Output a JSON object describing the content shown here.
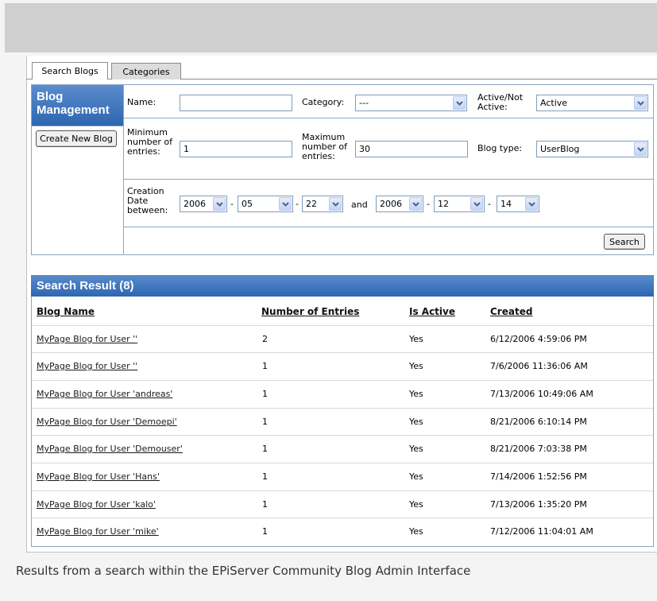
{
  "tabs": [
    {
      "label": "Search Blogs"
    },
    {
      "label": "Categories"
    }
  ],
  "sidebar": {
    "title": "Blog Management",
    "create_button": "Create New Blog"
  },
  "form": {
    "name_label": "Name:",
    "name_value": "",
    "category_label": "Category:",
    "category_value": "---",
    "active_label": "Active/Not Active:",
    "active_value": "Active",
    "min_entries_label": "Minimum number of entries:",
    "min_entries_value": "1",
    "max_entries_label": "Maximum number of entries:",
    "max_entries_value": "30",
    "blog_type_label": "Blog type:",
    "blog_type_value": "UserBlog",
    "creation_date_label": "Creation Date between:",
    "from_year": "2006",
    "from_month": "05",
    "from_day": "22",
    "and_label": "and",
    "to_year": "2006",
    "to_month": "12",
    "to_day": "14",
    "date_separator": "-",
    "search_button": "Search"
  },
  "results": {
    "title": "Search Result (8)",
    "columns": [
      "Blog Name",
      "Number of Entries",
      "Is Active",
      "Created"
    ],
    "rows": [
      {
        "name": "MyPage Blog for User ''",
        "entries": "2",
        "active": "Yes",
        "created": "6/12/2006 4:59:06 PM"
      },
      {
        "name": "MyPage Blog for User ''",
        "entries": "1",
        "active": "Yes",
        "created": "7/6/2006 11:36:06 AM"
      },
      {
        "name": "MyPage Blog for User 'andreas'",
        "entries": "1",
        "active": "Yes",
        "created": "7/13/2006 10:49:06 AM"
      },
      {
        "name": "MyPage Blog for User 'Demoepi'",
        "entries": "1",
        "active": "Yes",
        "created": "8/21/2006 6:10:14 PM"
      },
      {
        "name": "MyPage Blog for User 'Demouser'",
        "entries": "1",
        "active": "Yes",
        "created": "8/21/2006 7:03:38 PM"
      },
      {
        "name": "MyPage Blog for User 'Hans'",
        "entries": "1",
        "active": "Yes",
        "created": "7/14/2006 1:52:56 PM"
      },
      {
        "name": "MyPage Blog for User 'kalo'",
        "entries": "1",
        "active": "Yes",
        "created": "7/13/2006 1:35:20 PM"
      },
      {
        "name": "MyPage Blog for User 'mike'",
        "entries": "1",
        "active": "Yes",
        "created": "7/12/2006 11:04:01 AM"
      }
    ]
  },
  "caption": "Results from a search within the EPiServer Community Blog Admin Interface",
  "colors": {
    "header_gradient_top": "#5b8ccc",
    "header_gradient_bottom": "#2d66b0",
    "border": "#8fa5c0"
  }
}
